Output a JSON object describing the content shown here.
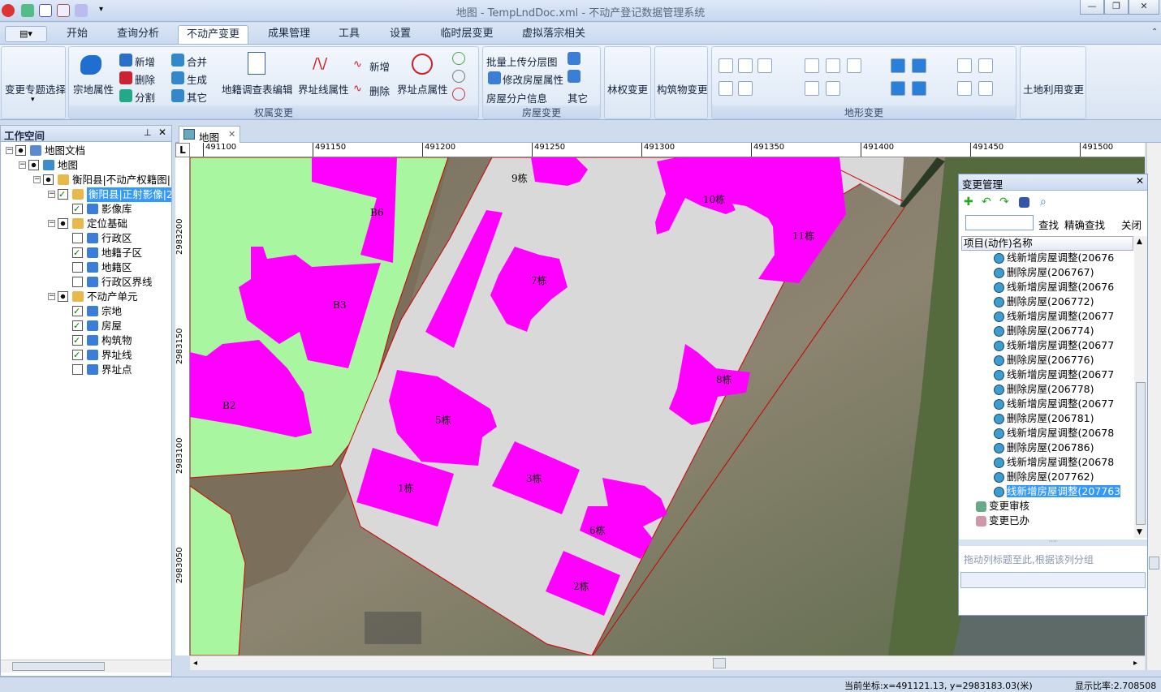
{
  "window": {
    "title": "地图 - TempLndDoc.xml - 不动产登记数据管理系统",
    "min": "—",
    "max": "❐",
    "close": "✕"
  },
  "menu": {
    "tabs": [
      "开始",
      "查询分析",
      "不动产变更",
      "成果管理",
      "工具",
      "设置",
      "临时层变更",
      "虚拟落宗相关"
    ],
    "active": "不动产变更"
  },
  "ribbon": {
    "change_topic": "变更专题选择",
    "parcel_attr": "宗地属性",
    "add": "新增",
    "delete": "删除",
    "split": "分割",
    "merge": "合并",
    "generate": "生成",
    "other": "其它",
    "survey_table": "地籍调查表编辑",
    "boundary_line_attr": "界址线属性",
    "bl_add": "新增",
    "bl_delete": "删除",
    "boundary_point_attr": "界址点属性",
    "group_rights": "权属变更",
    "batch_upload": "批量上传分层图",
    "modify_house": "修改房屋属性",
    "house_units": "房屋分户信息",
    "house_other": "其它",
    "group_house": "房屋变更",
    "forest_change": "林权变更",
    "structure_change": "构筑物变更",
    "group_terrain": "地形变更",
    "land_use_change": "土地利用变更"
  },
  "workspace": {
    "title": "工作空间",
    "tree": [
      {
        "label": "地图文档",
        "level": 0
      },
      {
        "label": "地图",
        "level": 1
      },
      {
        "label": "衡阳县|不动产权籍图|",
        "level": 2
      },
      {
        "label": "衡阳县|正射影像|2",
        "level": 3,
        "checked": true,
        "selected": true
      },
      {
        "label": "影像库",
        "level": 4,
        "checked": true
      },
      {
        "label": "定位基础",
        "level": 3
      },
      {
        "label": "行政区",
        "level": 4,
        "checked": false
      },
      {
        "label": "地籍子区",
        "level": 4,
        "checked": true
      },
      {
        "label": "地籍区",
        "level": 4,
        "checked": false
      },
      {
        "label": "行政区界线",
        "level": 4,
        "checked": false
      },
      {
        "label": "不动产单元",
        "level": 3
      },
      {
        "label": "宗地",
        "level": 4,
        "checked": true
      },
      {
        "label": "房屋",
        "level": 4,
        "checked": true
      },
      {
        "label": "构筑物",
        "level": 4,
        "checked": true
      },
      {
        "label": "界址线",
        "level": 4,
        "checked": true
      },
      {
        "label": "界址点",
        "level": 4,
        "checked": false
      }
    ]
  },
  "doc_tab": "地图",
  "ruler": {
    "x": [
      "491100",
      "491150",
      "491200",
      "491250",
      "491300",
      "491350",
      "491400",
      "491450",
      "491500"
    ],
    "y": [
      "2983200",
      "2983150",
      "2983100",
      "2983050"
    ]
  },
  "map_labels": [
    "9栋",
    "10栋",
    "11栋",
    "B6",
    "7栋",
    "B3",
    "8栋",
    "B2",
    "5栋",
    "1栋",
    "3栋",
    "6栋",
    "2栋"
  ],
  "change_mgmt": {
    "title": "变更管理",
    "find": "查找",
    "exact": "精确查找",
    "close": "关闭",
    "column": "项目(动作)名称",
    "items": [
      "线新增房屋调整(20676",
      "删除房屋(206767)",
      "线新增房屋调整(20676",
      "删除房屋(206772)",
      "线新增房屋调整(20677",
      "删除房屋(206774)",
      "线新增房屋调整(20677",
      "删除房屋(206776)",
      "线新增房屋调整(20677",
      "删除房屋(206778)",
      "线新增房屋调整(20677",
      "删除房屋(206781)",
      "线新增房屋调整(20678",
      "删除房屋(206786)",
      "线新增房屋调整(20678",
      "删除房屋(207762)",
      "线新增房屋调整(207763"
    ],
    "review": "变更审核",
    "done": "变更已办",
    "group_hint": "拖动列标题至此,根据该列分组"
  },
  "status": {
    "coords": "当前坐标:x=491121.13, y=2983183.03(米)",
    "scale": "显示比率:2.708508"
  },
  "colors": {
    "building": "#ff00ff",
    "green": "#a8f7a0",
    "parcel": "#d9d9d9",
    "accent": "#3399ff"
  }
}
